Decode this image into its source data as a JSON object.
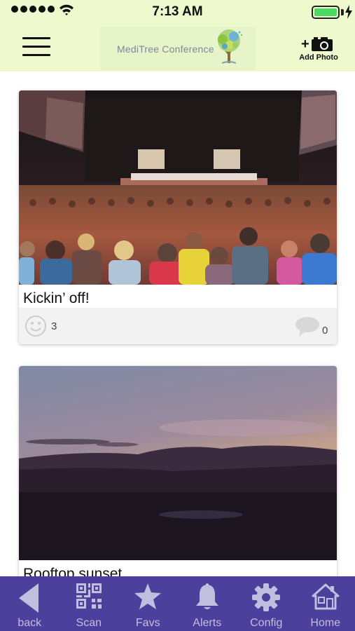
{
  "status_bar": {
    "time": "7:13 AM",
    "signal_icon": "signal-dots-icon",
    "wifi_icon": "wifi-icon",
    "battery_icon": "battery-icon",
    "battery_level": 1.0,
    "charging_icon": "bolt-icon"
  },
  "header": {
    "menu_icon": "hamburger-menu-icon",
    "logo_text": "MediTree Conference",
    "logo_icon": "tree-logo-icon",
    "add_photo_label": "Add Photo",
    "add_photo_icon": "camera-icon"
  },
  "posts": [
    {
      "caption": "Kickin’ off!",
      "likes": "3",
      "comments": "0",
      "image": "conference-hall-crowd"
    },
    {
      "caption": "Rooftop sunset",
      "image": "sunset-over-city"
    }
  ],
  "tabbar": {
    "tabs": [
      {
        "label": "back",
        "icon": "back-arrow-icon"
      },
      {
        "label": "Scan",
        "icon": "qr-code-icon"
      },
      {
        "label": "Favs",
        "icon": "star-icon"
      },
      {
        "label": "Alerts",
        "icon": "bell-icon"
      },
      {
        "label": "Config",
        "icon": "gear-icon"
      },
      {
        "label": "Home",
        "icon": "home-icon"
      }
    ]
  },
  "colors": {
    "header_bg": "#eefacd",
    "tabbar_bg": "#4d3f9c",
    "tab_icon": "#c2bee0"
  }
}
